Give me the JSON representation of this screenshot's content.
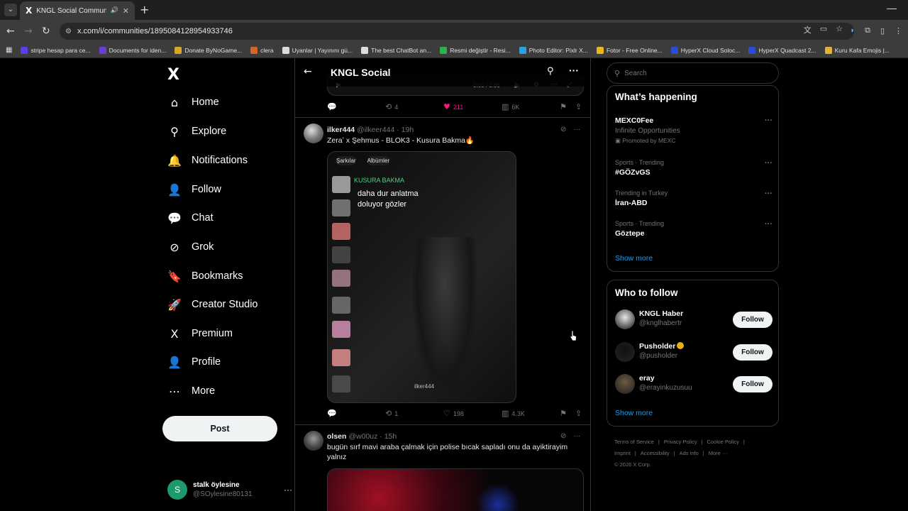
{
  "browser": {
    "tab_title": "KNGL Social Community / X",
    "tab_audio_icon": "speaker-icon",
    "url": "x.com/i/communities/1895084128954933746",
    "bookmarks": [
      {
        "label": "stripe hesap para ce...",
        "color": "#5b3df5"
      },
      {
        "label": "Documents for iden...",
        "color": "#6b3fd1"
      },
      {
        "label": "Donate ByNoGame...",
        "color": "#d8a72a"
      },
      {
        "label": "clera",
        "color": "#d9622b"
      },
      {
        "label": "Uyanlar | Yayınını gü...",
        "color": "#dddddd"
      },
      {
        "label": "The best ChatBot an...",
        "color": "#dddddd"
      },
      {
        "label": "Resmi değiştir - Resi...",
        "color": "#2bb34a"
      },
      {
        "label": "Photo Editor: Pixlr X...",
        "color": "#2aa3e0"
      },
      {
        "label": "Fotor - Free Online...",
        "color": "#e9b61d"
      },
      {
        "label": "HyperX Cloud Soloc...",
        "color": "#2c4bd6"
      },
      {
        "label": "HyperX Quadcast 2...",
        "color": "#2c4bd6"
      },
      {
        "label": "Kuru Kafa Emojis |...",
        "color": "#e0b43a"
      }
    ]
  },
  "nav": {
    "items": [
      {
        "label": "Home",
        "icon": "⌂",
        "name": "home"
      },
      {
        "label": "Explore",
        "icon": "⚲",
        "name": "explore"
      },
      {
        "label": "Notifications",
        "icon": "🔔",
        "name": "notifications"
      },
      {
        "label": "Follow",
        "icon": "👤",
        "name": "follow"
      },
      {
        "label": "Chat",
        "icon": "💬",
        "name": "chat"
      },
      {
        "label": "Grok",
        "icon": "⊘",
        "name": "grok"
      },
      {
        "label": "Bookmarks",
        "icon": "🔖",
        "name": "bookmarks"
      },
      {
        "label": "Creator Studio",
        "icon": "🚀",
        "name": "creator-studio"
      },
      {
        "label": "Premium",
        "icon": "X",
        "name": "premium"
      },
      {
        "label": "Profile",
        "icon": "👤",
        "name": "profile"
      },
      {
        "label": "More",
        "icon": "⋯",
        "name": "more"
      }
    ],
    "post_label": "Post",
    "account": {
      "avatar_letter": "S",
      "name": "stalk öylesine",
      "handle": "@SOylesine80131"
    }
  },
  "main": {
    "title": "KNGL Social",
    "prev_post": {
      "video_time": "0:00 / 0:06",
      "replies": "",
      "reposts": "4",
      "likes": "211",
      "views": "6K"
    },
    "posts": [
      {
        "name": "ilker444",
        "handle": "@ilkeer444",
        "time": "19h",
        "text": "Zeraʼ x Şehmus - BLOK3 - Kusura Bakma🔥",
        "media": {
          "tabs": [
            "Şarkılar",
            "Albümler"
          ],
          "song": "KUSURA BAKMA",
          "lyric_1": "daha dur anlatma",
          "lyric_2": "doluyor gözler",
          "watermark": "ilker444"
        },
        "replies": "",
        "reposts": "1",
        "likes": "198",
        "views": "4.3K"
      },
      {
        "name": "olsen",
        "handle": "@w00uz",
        "time": "15h",
        "text": "bugün sırf mavi araba çalmak için polise bıcak sapladı onu da ayiktirayim yalnız"
      }
    ]
  },
  "right": {
    "search_placeholder": "Search",
    "happening_title": "What’s happening",
    "trends": [
      {
        "meta": "",
        "name": "MEXC0Fee",
        "sub": "Infinite Opportunities",
        "promo": "Promoted by MEXC"
      },
      {
        "meta": "Sports · Trending",
        "name": "#GÖZvGS",
        "sub": "",
        "promo": ""
      },
      {
        "meta": "Trending in Turkey",
        "name": "İran-ABD",
        "sub": "",
        "promo": ""
      },
      {
        "meta": "Sports · Trending",
        "name": "Göztepe",
        "sub": "",
        "promo": ""
      }
    ],
    "show_more": "Show more",
    "who_title": "Who to follow",
    "follow_suggestions": [
      {
        "name": "KNGL Haber",
        "handle": "@knglhabertr",
        "verified": false,
        "button": "Follow",
        "avatar_color": "#e8e8e8"
      },
      {
        "name": "Pusholder",
        "handle": "@pusholder",
        "verified": true,
        "button": "Follow",
        "avatar_color": "#111111"
      },
      {
        "name": "eray",
        "handle": "@erayinkuzusuu",
        "verified": false,
        "button": "Follow",
        "avatar_color": "#6e5a43"
      }
    ],
    "show_more_2": "Show more",
    "footer": [
      "Terms of Service",
      "|",
      "Privacy Policy",
      "|",
      "Cookie Policy",
      "|",
      "Imprint",
      "|",
      "Accessibility",
      "|",
      "Ads info",
      "|",
      "More ···",
      "© 2026 X Corp."
    ]
  }
}
